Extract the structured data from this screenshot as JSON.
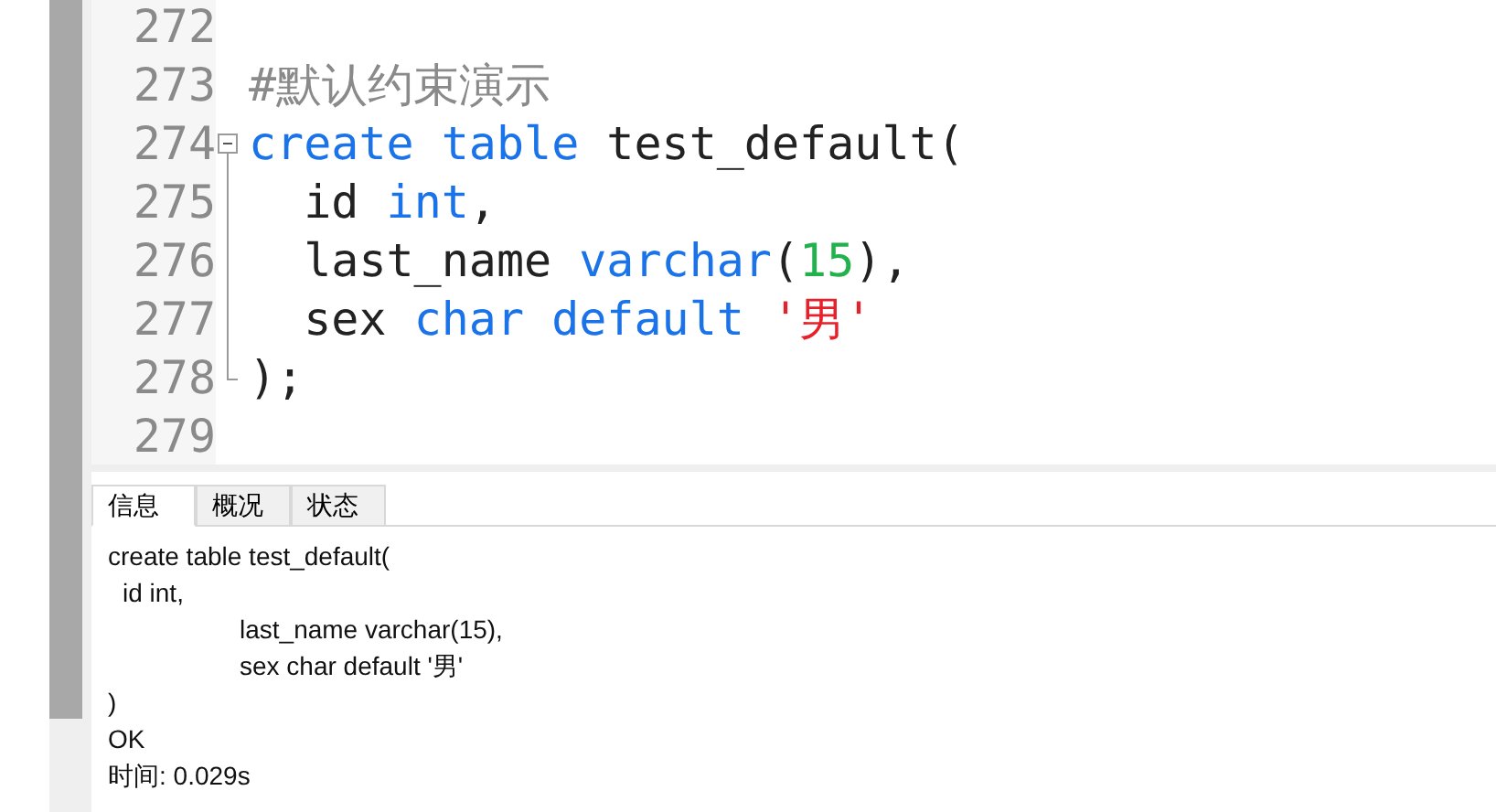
{
  "editor": {
    "lines": [
      {
        "number": "272",
        "kind": "blank"
      },
      {
        "number": "273",
        "kind": "plain",
        "tokens": [
          {
            "kind": "comment",
            "text": "#默认约束演示"
          }
        ]
      },
      {
        "number": "274",
        "kind": "fold_start",
        "tokens": [
          {
            "kind": "keyword",
            "text": "create"
          },
          {
            "kind": "keyword",
            "text": " table"
          },
          {
            "kind": "plain",
            "text": " test_default("
          }
        ]
      },
      {
        "number": "275",
        "kind": "fold_inner",
        "tokens": [
          {
            "kind": "plain",
            "text": "  id "
          },
          {
            "kind": "keyword",
            "text": "int"
          },
          {
            "kind": "plain",
            "text": ","
          }
        ]
      },
      {
        "number": "276",
        "kind": "fold_inner",
        "tokens": [
          {
            "kind": "plain",
            "text": "  last_name "
          },
          {
            "kind": "keyword",
            "text": "varchar"
          },
          {
            "kind": "plain",
            "text": "("
          },
          {
            "kind": "number",
            "text": "15"
          },
          {
            "kind": "plain",
            "text": "),"
          }
        ]
      },
      {
        "number": "277",
        "kind": "fold_inner",
        "tokens": [
          {
            "kind": "plain",
            "text": "  sex "
          },
          {
            "kind": "keyword",
            "text": "char"
          },
          {
            "kind": "keyword",
            "text": " default"
          },
          {
            "kind": "string",
            "text": " '男'"
          }
        ]
      },
      {
        "number": "278",
        "kind": "fold_end",
        "tokens": [
          {
            "kind": "plain",
            "text": ");"
          }
        ]
      },
      {
        "number": "279",
        "kind": "blank"
      }
    ]
  },
  "tabs": [
    {
      "label": "信息",
      "selected": true
    },
    {
      "label": "概况",
      "selected": false
    },
    {
      "label": "状态",
      "selected": false
    }
  ],
  "output": [
    {
      "kind": "plain",
      "text": "create table test_default("
    },
    {
      "kind": "space_indent",
      "text": "id int,"
    },
    {
      "kind": "tab_indent",
      "text": "last_name varchar(15),"
    },
    {
      "kind": "tab_indent",
      "text": "sex char default '男'"
    },
    {
      "kind": "plain",
      "text": ")"
    },
    {
      "kind": "plain",
      "text": "OK"
    },
    {
      "kind": "plain",
      "text": "时间: 0.029s"
    }
  ]
}
